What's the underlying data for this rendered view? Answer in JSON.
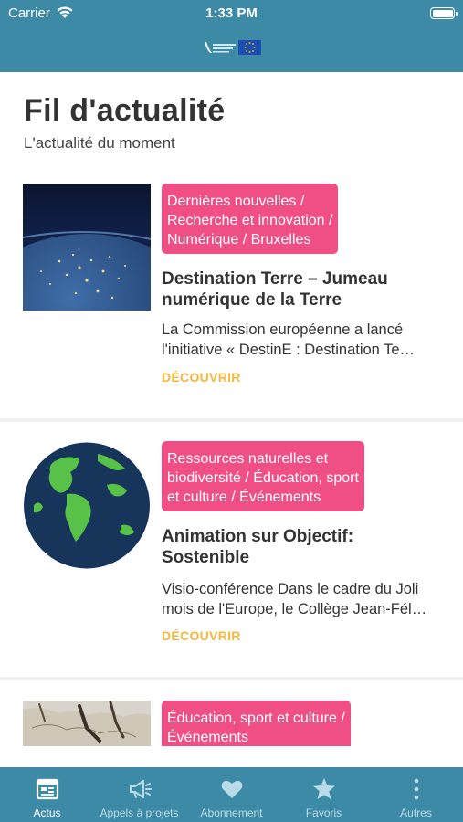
{
  "status_bar": {
    "carrier": "Carrier",
    "time": "1:33 PM"
  },
  "page": {
    "title": "Fil d'actualité",
    "subtitle": "L'actualité du moment"
  },
  "news": [
    {
      "tag": "Dernières nouvelles /\nRecherche et innovation /\nNumérique / Bruxelles",
      "title": "Destination Terre – Jumeau\nnumérique de la Terre",
      "description": "La Commission européenne a lancé\nl'initiative « DestinE : Destination Te…",
      "cta": "DÉCOUVRIR"
    },
    {
      "tag": "Ressources naturelles et\nbiodiversité / Éducation, sport\net culture / Événements",
      "title": "Animation sur Objectif:\nSostenible",
      "description": "Visio-conférence Dans le cadre du Joli\nmois de l'Europe, le Collège Jean-Fél…",
      "cta": "DÉCOUVRIR"
    },
    {
      "tag": "Éducation, sport et culture /\nÉvénements"
    }
  ],
  "tabbar": {
    "items": [
      {
        "label": "Actus",
        "icon": "news-icon",
        "active": true
      },
      {
        "label": "Appels à projets",
        "icon": "megaphone-icon",
        "active": false
      },
      {
        "label": "Abonnement",
        "icon": "heart-icon",
        "active": false
      },
      {
        "label": "Favoris",
        "icon": "star-icon",
        "active": false
      },
      {
        "label": "Autres",
        "icon": "more-icon",
        "active": false
      }
    ]
  },
  "colors": {
    "header": "#3d8aa6",
    "tag": "#ef4f84",
    "cta": "#f5b83e",
    "text": "#333333"
  }
}
